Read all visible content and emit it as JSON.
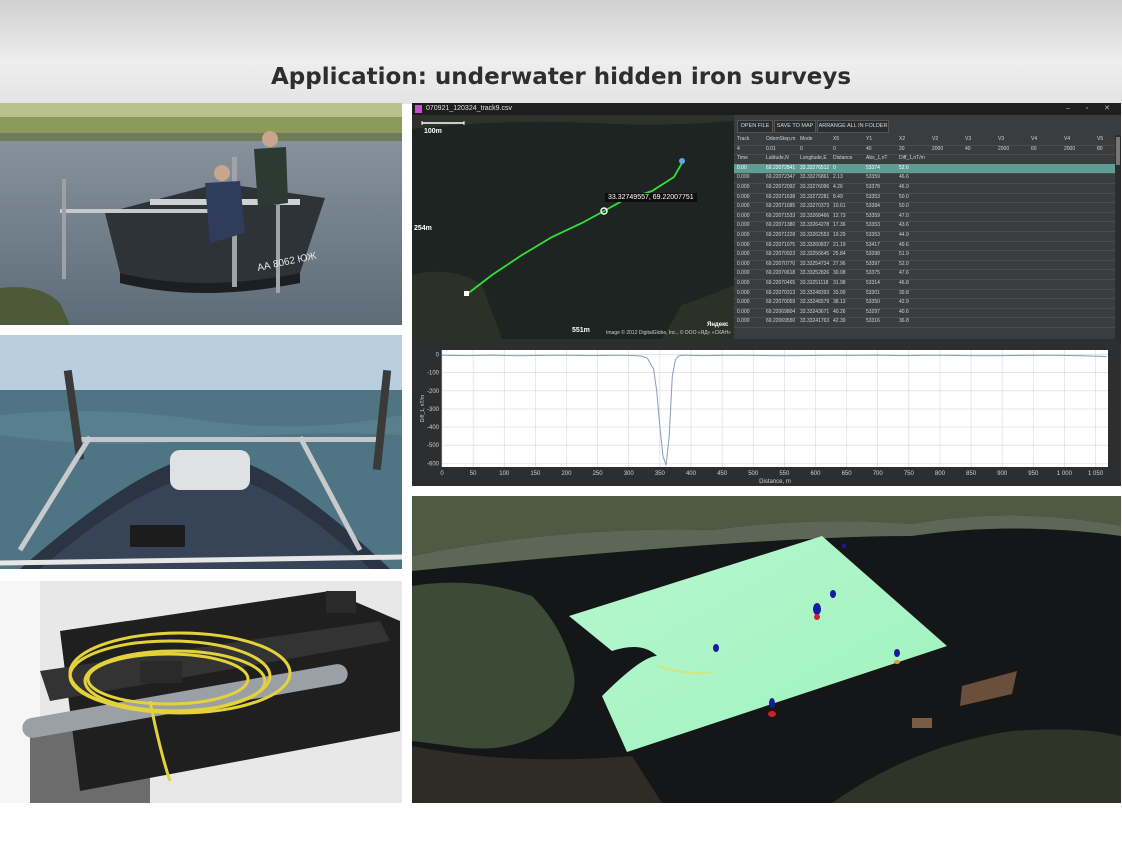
{
  "slide": {
    "title": "Application: underwater hidden iron surveys"
  },
  "app": {
    "window_title": "070921_120324_track9.csv",
    "window_controls": "– ▫ ✕",
    "buttons": {
      "open_file": "OPEN FILE",
      "save_to_map": "SAVE TO MAP",
      "arrange": "ARRANGE ALL IN FOLDER"
    },
    "map": {
      "scale_label": "100m",
      "left_label": "254m",
      "bottom_label": "551m",
      "coordinate_tip": "33.32749557, 69.22007751",
      "credit": "Image © 2012 DigitalGlobe, Inc., © ООО «ЯД» «СКАН»",
      "provider": "Яндекс"
    },
    "params": {
      "headers": [
        "Track",
        "OdomStep,m",
        "Mode",
        "X5",
        "Y1",
        "X2",
        "V2",
        "V3",
        "V3",
        "V4",
        "V4",
        "V5"
      ],
      "values": [
        "4",
        "0.01",
        "0",
        "0",
        "40",
        "20",
        "2000",
        "40",
        "2000",
        "60",
        "2000",
        "80"
      ]
    },
    "table": {
      "headers": [
        "Time",
        "Latitude,N",
        "Longitude,E",
        "Distance",
        "Abs_1,nT",
        "Diff_1,nT/m"
      ],
      "rows": [
        [
          "0.00",
          "69.22072841",
          "33.33276512",
          "0",
          "53374",
          "52.6"
        ],
        [
          "0.000",
          "69.22072347",
          "33.33276861",
          "2.13",
          "53359",
          "46.6"
        ],
        [
          "0.000",
          "69.22072092",
          "33.33276096",
          "4.26",
          "53378",
          "46.9"
        ],
        [
          "0.000",
          "69.22071638",
          "33.33272281",
          "8.49",
          "53353",
          "50.0"
        ],
        [
          "0.000",
          "69.22071685",
          "33.33270373",
          "10.61",
          "53384",
          "50.0"
        ],
        [
          "0.000",
          "69.22071533",
          "33.33268466",
          "12.73",
          "53359",
          "47.0"
        ],
        [
          "0.000",
          "69.22071380",
          "33.33264278",
          "17.36",
          "53353",
          "43.6"
        ],
        [
          "0.000",
          "69.22071228",
          "33.33262553",
          "19.29",
          "53353",
          "44.9"
        ],
        [
          "0.000",
          "69.22071075",
          "33.33260837",
          "21.19",
          "53417",
          "49.6"
        ],
        [
          "0.000",
          "69.22070923",
          "33.33256645",
          "25.84",
          "53398",
          "51.9"
        ],
        [
          "0.000",
          "69.22070770",
          "33.33254734",
          "27.96",
          "53397",
          "52.0"
        ],
        [
          "0.000",
          "69.22070618",
          "33.33252826",
          "30.08",
          "53375",
          "47.6"
        ],
        [
          "0.000",
          "69.22070465",
          "33.33251118",
          "31.98",
          "53314",
          "46.8"
        ],
        [
          "0.000",
          "69.22070313",
          "33.33248393",
          "33.99",
          "53301",
          "39.8"
        ],
        [
          "0.000",
          "69.22070059",
          "33.33246579",
          "38.13",
          "53350",
          "42.9"
        ],
        [
          "0.000",
          "69.22069804",
          "33.33243671",
          "40.26",
          "53297",
          "40.6"
        ],
        [
          "0.000",
          "69.22069550",
          "33.33241763",
          "42.39",
          "53316",
          "36.8"
        ]
      ]
    }
  },
  "chart_data": {
    "type": "line",
    "title": "",
    "xlabel": "Distance, m",
    "ylabel": "Diff_1, nT/m",
    "xlim": [
      0,
      1070
    ],
    "ylim": [
      -620,
      25
    ],
    "xticks": [
      0,
      50,
      100,
      150,
      200,
      250,
      300,
      350,
      400,
      450,
      500,
      550,
      600,
      650,
      700,
      750,
      800,
      850,
      900,
      950,
      1000,
      1050
    ],
    "xtick_labels": [
      "0",
      "50",
      "100",
      "150",
      "200",
      "250",
      "300",
      "350",
      "400",
      "450",
      "500",
      "550",
      "600",
      "650",
      "700",
      "750",
      "800",
      "850",
      "900",
      "950",
      "1 000",
      "1 050"
    ],
    "yticks": [
      0,
      -100,
      -200,
      -300,
      -400,
      -500,
      -600
    ],
    "ytick_labels": [
      "0",
      "-100",
      "-200",
      "-300",
      "-400",
      "-500",
      "-600"
    ],
    "grid": true,
    "colors": {
      "line": "#8a9bb5"
    },
    "series": [
      {
        "x": [
          0,
          40,
          80,
          120,
          160,
          200,
          240,
          280,
          300,
          320,
          330,
          340,
          345,
          350,
          355,
          360,
          365,
          370,
          375,
          380,
          385,
          390,
          395,
          400,
          420,
          460,
          500,
          540,
          580,
          620,
          660,
          700,
          740,
          780,
          820,
          860,
          900,
          940,
          980,
          1020,
          1040,
          1055,
          1068
        ],
        "y": [
          -4,
          -6,
          -3,
          -7,
          -5,
          -4,
          -6,
          -4,
          -5,
          -8,
          -20,
          -80,
          -200,
          -400,
          -560,
          -610,
          -450,
          -120,
          -30,
          -8,
          -5,
          -3,
          -4,
          -5,
          -6,
          -4,
          -5,
          -7,
          -6,
          -4,
          -5,
          -3,
          -6,
          -4,
          -5,
          -7,
          -6,
          -5,
          -4,
          -6,
          -8,
          -10,
          -12
        ]
      }
    ]
  },
  "survey_map": {
    "colors": {
      "background_field": "#a8f5c4",
      "anomaly_negative": "#1a1aa0",
      "anomaly_positive": "#d42020",
      "water": "#141618"
    }
  }
}
